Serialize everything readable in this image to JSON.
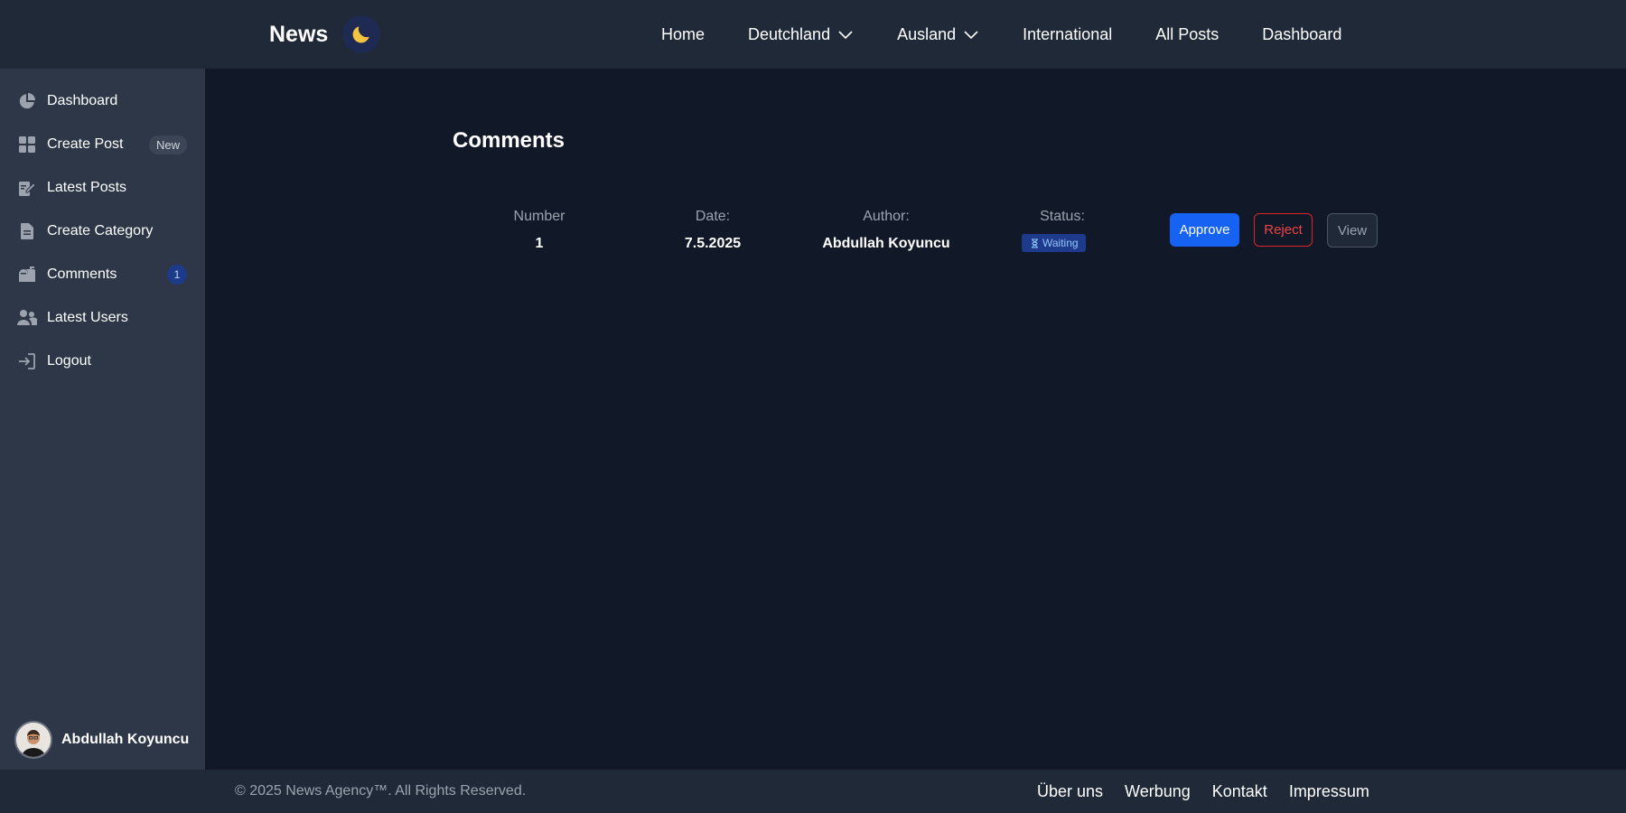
{
  "navbar": {
    "brand": "News",
    "theme_icon": "moon-icon",
    "links": [
      {
        "label": "Home"
      },
      {
        "label": "Deutchland",
        "has_dropdown": true
      },
      {
        "label": "Ausland",
        "has_dropdown": true
      },
      {
        "label": "International"
      },
      {
        "label": "All Posts"
      },
      {
        "label": "Dashboard"
      }
    ]
  },
  "sidebar": {
    "items": [
      {
        "label": "Dashboard",
        "icon": "pie-chart-icon"
      },
      {
        "label": "Create Post",
        "icon": "grid-icon",
        "badge": "New"
      },
      {
        "label": "Latest Posts",
        "icon": "edit-document-icon"
      },
      {
        "label": "Create Category",
        "icon": "document-icon"
      },
      {
        "label": "Comments",
        "icon": "mailbox-icon",
        "badge": "1"
      },
      {
        "label": "Latest Users",
        "icon": "users-icon"
      },
      {
        "label": "Logout",
        "icon": "logout-icon"
      }
    ],
    "user": {
      "name": "Abdullah Koyuncu"
    }
  },
  "main": {
    "title": "Comments",
    "columns": {
      "number_label": "Number",
      "date_label": "Date:",
      "author_label": "Author:",
      "status_label": "Status:"
    },
    "comment": {
      "number": "1",
      "date": "7.5.2025",
      "author": "Abdullah Koyuncu",
      "status": "Waiting"
    },
    "actions": {
      "approve": "Approve",
      "reject": "Reject",
      "view": "View"
    }
  },
  "footer": {
    "copyright": "© 2025 News Agency™. All Rights Reserved.",
    "links": [
      "Über uns",
      "Werbung",
      "Kontakt",
      "Impressum"
    ]
  },
  "colors": {
    "background": "#111827",
    "navbar": "#1f2937",
    "sidebar": "#2d3748",
    "primary": "#1663f3",
    "danger": "#dc2626",
    "badge": "#1e3a8a"
  }
}
